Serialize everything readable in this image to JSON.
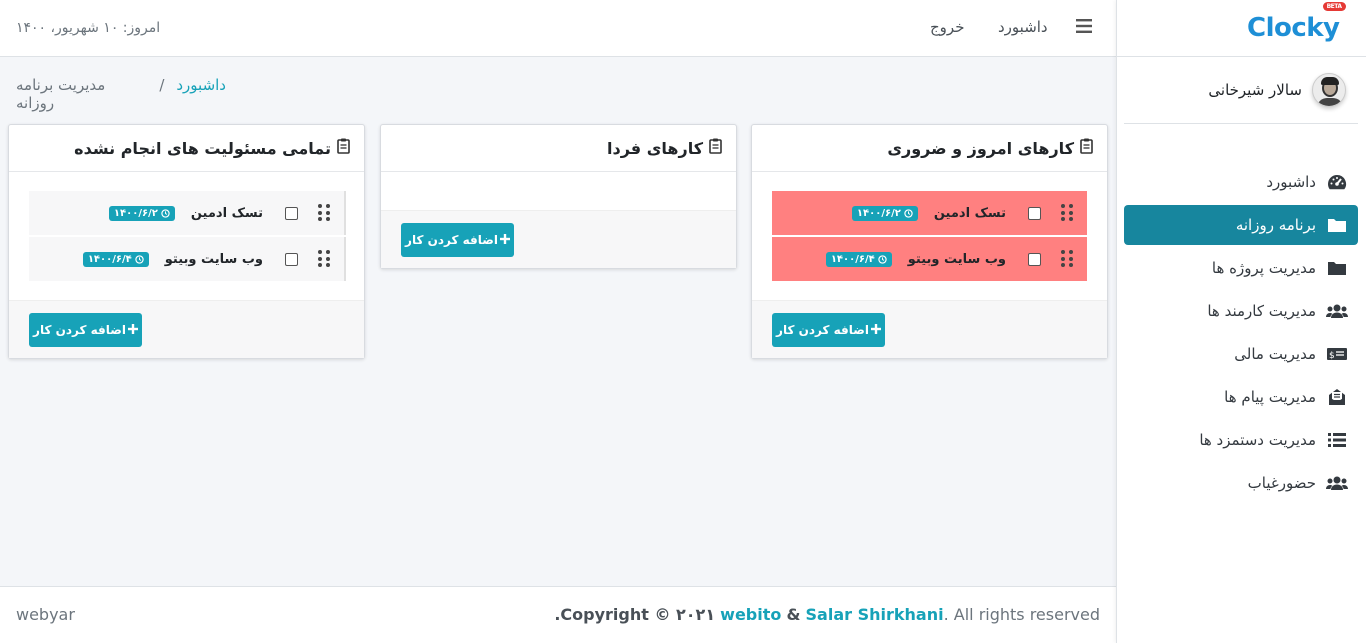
{
  "brand": {
    "name": "Clocky",
    "badge": "BETA"
  },
  "user": {
    "name": "سالار شیرخانی"
  },
  "sidebar": {
    "items": [
      {
        "label": "داشبورد",
        "icon": "speedometer-icon"
      },
      {
        "label": "برنامه روزانه",
        "icon": "folder-icon",
        "active": true
      },
      {
        "label": "مدیریت پروژه ها",
        "icon": "folder-icon"
      },
      {
        "label": "مدیریت کارمند ها",
        "icon": "users-icon"
      },
      {
        "label": "مدیریت مالی",
        "icon": "money-icon"
      },
      {
        "label": "مدیریت پیام ها",
        "icon": "mail-icon"
      },
      {
        "label": "مدیریت دستمزد ها",
        "icon": "list-icon"
      },
      {
        "label": "حضورغیاب",
        "icon": "users-icon"
      }
    ]
  },
  "topbar": {
    "dashboard_label": "داشبورد",
    "logout_label": "خروج",
    "date": "امروز: ۱۰ شهریور، ۱۴۰۰"
  },
  "breadcrumb": {
    "home": "داشبورد",
    "separator": "/",
    "current": "مدیریت برنامه روزانه"
  },
  "columns": [
    {
      "title": "کارهای امروز و ضروری",
      "add_label": "اضافه کردن کار",
      "tasks": [
        {
          "name": "تسک ادمین",
          "date": "۱۴۰۰/۶/۲"
        },
        {
          "name": "وب سایت وبیتو",
          "date": "۱۴۰۰/۶/۴"
        }
      ]
    },
    {
      "title": "کارهای فردا",
      "add_label": "اضافه کردن کار",
      "tasks": []
    },
    {
      "title": "تمامی مسئولیت های انجام نشده",
      "add_label": "اضافه کردن کار",
      "tasks": [
        {
          "name": "تسک ادمین",
          "date": "۱۴۰۰/۶/۲"
        },
        {
          "name": "وب سایت وبیتو",
          "date": "۱۴۰۰/۶/۴"
        }
      ]
    }
  ],
  "footer": {
    "left": "webyar",
    "copyright_prefix": "Copyright © ۲۰۲۱",
    "link1": "webito",
    "amp": "&",
    "link2": "Salar Shirkhani",
    "suffix": ". All rights reserved",
    "period": "."
  },
  "colors": {
    "accent": "#17a2b8",
    "active_nav": "#17869e",
    "urgent": "#ff8080"
  }
}
